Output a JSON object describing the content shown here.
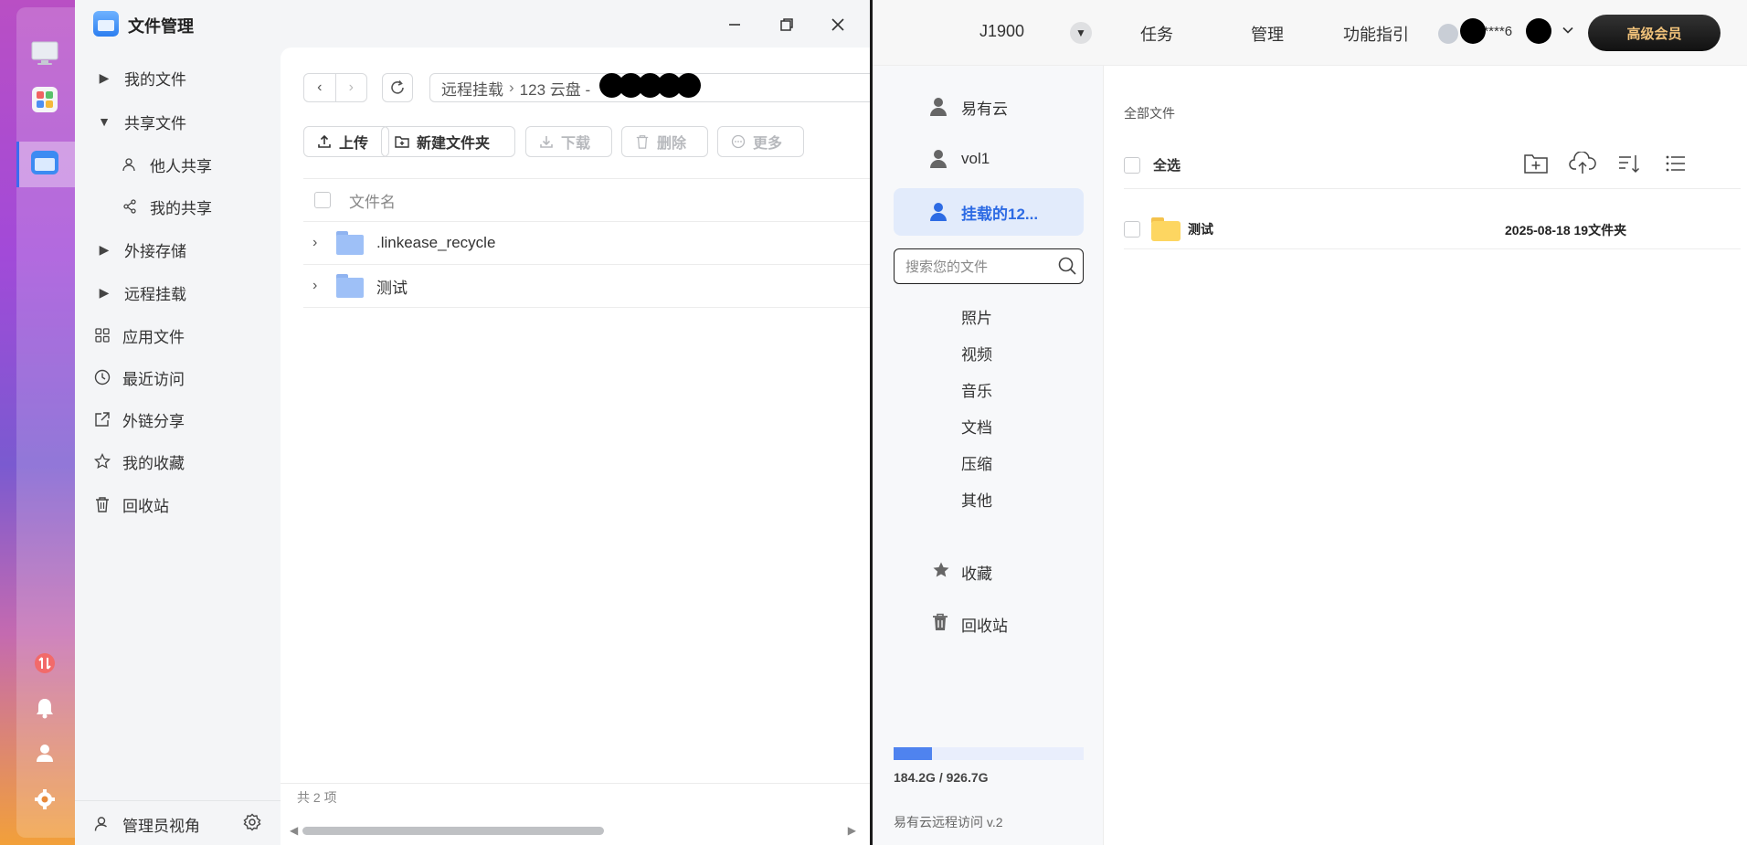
{
  "file_manager": {
    "title": "文件管理",
    "sidebar": {
      "items": [
        {
          "label": "我的文件"
        },
        {
          "label": "共享文件"
        },
        {
          "label": "他人共享"
        },
        {
          "label": "我的共享"
        },
        {
          "label": "外接存储"
        },
        {
          "label": "远程挂载"
        },
        {
          "label": "应用文件"
        },
        {
          "label": "最近访问"
        },
        {
          "label": "外链分享"
        },
        {
          "label": "我的收藏"
        },
        {
          "label": "回收站"
        }
      ],
      "admin_view": "管理员视角"
    },
    "path": {
      "segment1": "远程挂载",
      "separator": "›",
      "segment2": "123 云盘 -"
    },
    "toolbar": {
      "upload": "上传",
      "new_folder": "新建文件夹",
      "download": "下载",
      "delete": "删除",
      "more": "更多"
    },
    "list": {
      "column_name": "文件名",
      "rows": [
        {
          "name": ".linkease_recycle"
        },
        {
          "name": "测试"
        }
      ]
    },
    "footer": "共 2 项"
  },
  "yiyouyun": {
    "header": {
      "device": "J1900",
      "tasks": "任务",
      "manage": "管理",
      "guide": "功能指引",
      "user": "3****6",
      "vip": "高级会员"
    },
    "sidebar": {
      "accounts": [
        {
          "label": "易有云"
        },
        {
          "label": "vol1"
        },
        {
          "label": "挂载的12..."
        }
      ],
      "search_placeholder": "搜索您的文件",
      "categories": [
        "照片",
        "视频",
        "音乐",
        "文档",
        "压缩",
        "其他"
      ],
      "favorites": "收藏",
      "recycle": "回收站",
      "usage": {
        "text": "184.2G / 926.7G",
        "used_fraction": 0.2
      },
      "version": "易有云远程访问 v.2"
    },
    "main": {
      "breadcrumb": "全部文件",
      "select_all": "全选",
      "rows": [
        {
          "name": "测试",
          "info": "2025-08-18 19文件夹"
        }
      ]
    }
  }
}
